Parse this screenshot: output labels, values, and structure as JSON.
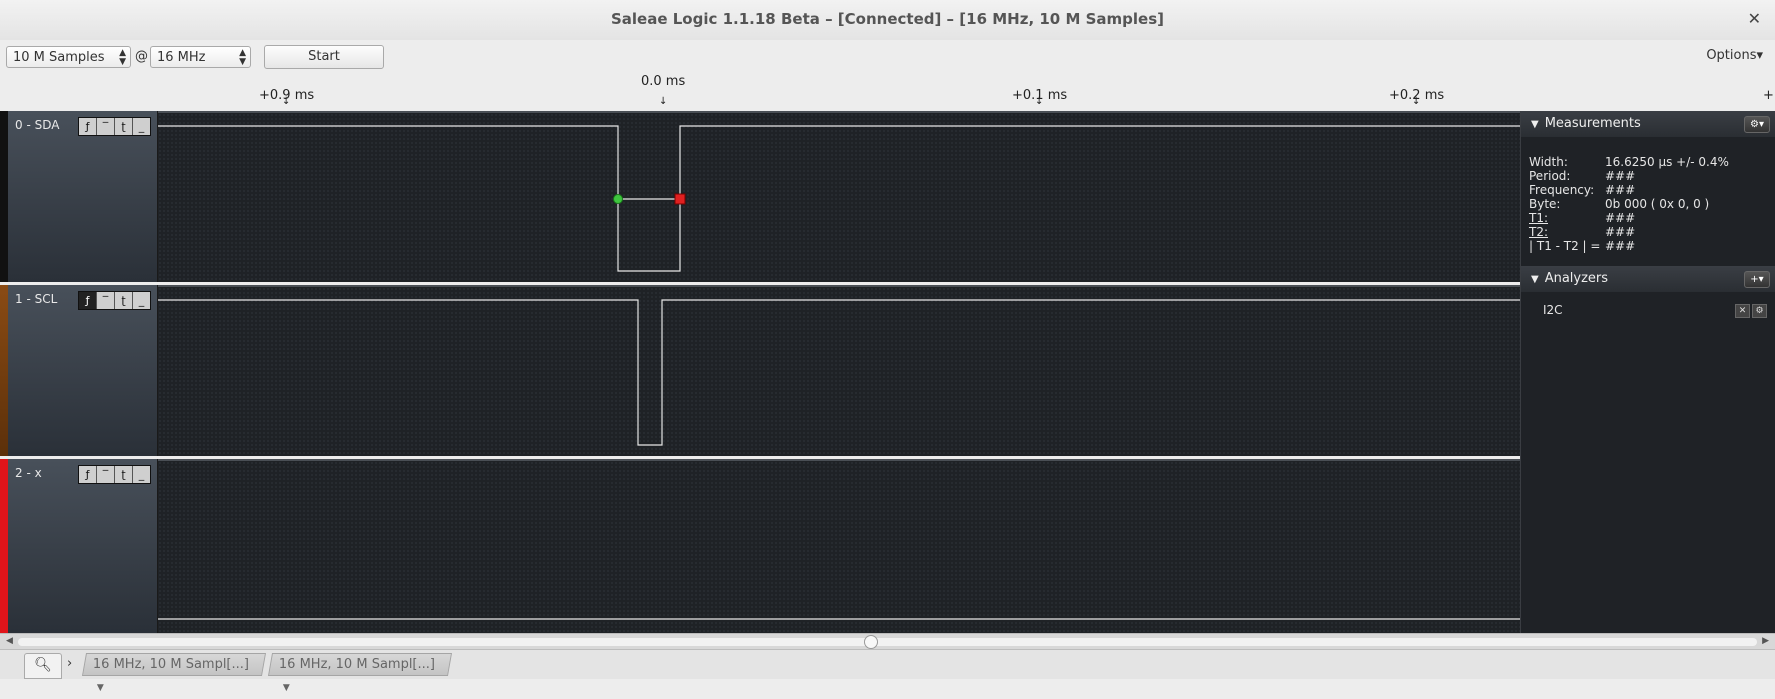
{
  "window": {
    "title": "Saleae Logic 1.1.18 Beta – [Connected] – [16 MHz, 10 M Samples]",
    "close_glyph": "✕"
  },
  "toolbar": {
    "samples_value": "10 M Samples",
    "at_label": "@",
    "rate_value": "16 MHz",
    "start_label": "Start",
    "options_label": "Options▾"
  },
  "ruler": {
    "center_label": "0.0 ms",
    "ticks": [
      "+0.9 ms",
      "+0.1 ms",
      "+0.2 ms"
    ],
    "tick_marker": "↓",
    "end_marker": "+"
  },
  "channels": [
    {
      "name": "0 - SDA",
      "color": "#111111"
    },
    {
      "name": "1 - SCL",
      "color": "#8a4b14"
    },
    {
      "name": "2 - x",
      "color": "#e0141a"
    }
  ],
  "trigger_buttons": [
    "ƒ",
    "‾",
    "ʈ",
    "_"
  ],
  "measurements": {
    "header": "Measurements",
    "rows": [
      {
        "key": "Width:",
        "value": "16.6250 µs +/- 0.4%"
      },
      {
        "key": "Period:",
        "value": "###"
      },
      {
        "key": "Frequency:",
        "value": "###"
      },
      {
        "key": "Byte:",
        "value": "0b  000 ( 0x 0, 0 )"
      },
      {
        "key": "T1:",
        "value": "###"
      },
      {
        "key": "T2:",
        "value": "###"
      },
      {
        "key": "| T1 - T2 | =",
        "value": "###"
      }
    ]
  },
  "analyzers": {
    "header": "Analyzers",
    "add_glyph": "+▾",
    "items": [
      "I2C"
    ]
  },
  "tabs": [
    "16 MHz, 10 M Sampl[...]",
    "16 MHz, 10 M Sampl[...]"
  ],
  "icons": {
    "search": "search-icon",
    "gear": "gear-icon",
    "collapse": "triangle-down-icon"
  }
}
